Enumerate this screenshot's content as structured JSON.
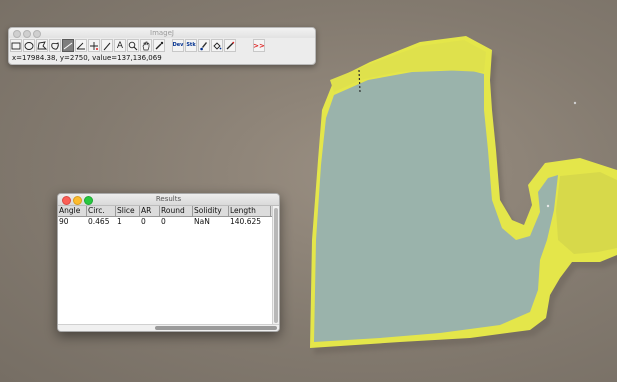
{
  "toolbar_window": {
    "title": "ImageJ",
    "status": "x=17984.38, y=2750, value=137,136,069",
    "tools": [
      {
        "name": "rectangle-tool",
        "label": ""
      },
      {
        "name": "oval-tool",
        "label": ""
      },
      {
        "name": "polygon-tool",
        "label": ""
      },
      {
        "name": "freehand-tool",
        "label": ""
      },
      {
        "name": "straight-line-tool",
        "label": ""
      },
      {
        "name": "angle-tool",
        "label": ""
      },
      {
        "name": "point-tool",
        "label": ""
      },
      {
        "name": "wand-tool",
        "label": ""
      },
      {
        "name": "text-tool",
        "label": "A"
      },
      {
        "name": "magnifying-glass-tool",
        "label": ""
      },
      {
        "name": "scrolling-tool",
        "label": ""
      },
      {
        "name": "color-picker-tool",
        "label": ""
      },
      {
        "name": "developer-menu-tool",
        "label": "Dev"
      },
      {
        "name": "stack-tools",
        "label": "Stk"
      },
      {
        "name": "brush-tool",
        "label": ""
      },
      {
        "name": "flood-fill-tool",
        "label": ""
      },
      {
        "name": "pencil-tool",
        "label": ""
      },
      {
        "name": "more-tools",
        "label": ">>"
      }
    ]
  },
  "results_window": {
    "title": "Results",
    "columns": [
      "Angle",
      "Circ.",
      "Slice",
      "AR",
      "Round",
      "Solidity",
      "Length"
    ],
    "rows": [
      [
        "90",
        "0.465",
        "1",
        "0",
        "0",
        "NaN",
        "140.625"
      ]
    ]
  },
  "colors": {
    "specimen": "#9ab3ab",
    "specimen_edge": "#e6e84a",
    "background": "#857b70",
    "close_light": "#fc5f57",
    "minimize_light": "#fdbc2e",
    "zoom_light": "#28c840"
  }
}
